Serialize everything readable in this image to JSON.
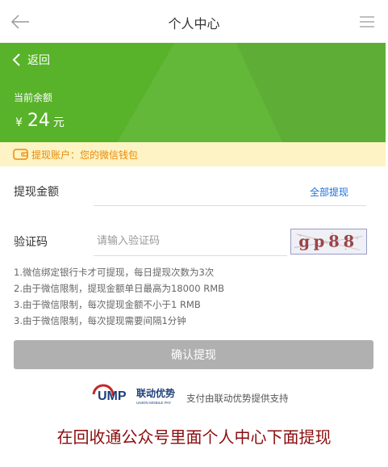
{
  "header": {
    "title": "个人中心",
    "back_icon": "back-arrow-icon",
    "menu_icon": "hamburger-menu-icon"
  },
  "banner": {
    "back_label": "返回",
    "balance_label": "当前余额",
    "currency": "¥",
    "amount": "24",
    "unit": "元",
    "color": "#58b22a"
  },
  "notice": {
    "text": "提现账户：您的微信钱包",
    "icon": "wallet-icon",
    "color": "#e98a0a"
  },
  "form": {
    "amount_label": "提现金额",
    "withdraw_all": "全部提现",
    "code_label": "验证码",
    "code_placeholder": "请输入验证码",
    "captcha_text": "gp88"
  },
  "rules": [
    "1.微信绑定银行卡才可提现，每日提现次数为3次",
    "2.由于微信限制，提现金额单日最高为18000 RMB",
    "3.由于微信限制，每次提现金额不小于1 RMB",
    "3.由于微信限制，每次提现需要间隔1分钟"
  ],
  "confirm_button": "确认提现",
  "footer": {
    "logo_text": "UMP",
    "logo_cn": "联动优势",
    "logo_en": "UNION MOBILE PAY",
    "support_text": "支付由联动优势提供支持"
  },
  "caption": "在回收通公众号里面个人中心下面提现"
}
